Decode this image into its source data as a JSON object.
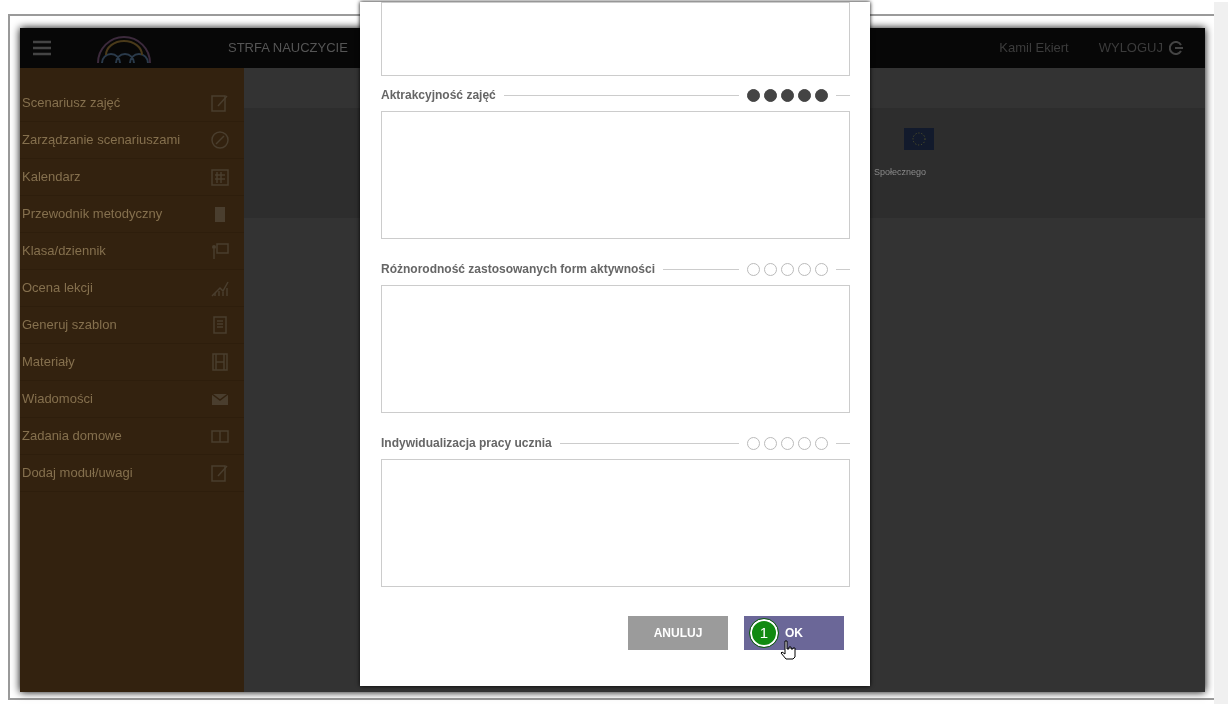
{
  "header": {
    "brand": "STRFA NAUCZYCIE",
    "user": "Kamil Ekiert",
    "logout": "WYLOGUJ"
  },
  "sidebar": {
    "items": [
      {
        "label": "Scenariusz zajęć",
        "kind": "edit"
      },
      {
        "label": "Zarządzanie scenariuszami",
        "kind": "compass"
      },
      {
        "label": "Kalendarz",
        "kind": "calendar"
      },
      {
        "label": "Przewodnik metodyczny",
        "kind": "book"
      },
      {
        "label": "Klasa/dziennik",
        "kind": "board"
      },
      {
        "label": "Ocena lekcji",
        "kind": "chart"
      },
      {
        "label": "Generuj szablon",
        "kind": "doc"
      },
      {
        "label": "Materiały",
        "kind": "film"
      },
      {
        "label": "Wiadomości",
        "kind": "mail"
      },
      {
        "label": "Zadania domowe",
        "kind": "openbook"
      },
      {
        "label": "Dodaj moduł/uwagi",
        "kind": "edit"
      }
    ]
  },
  "footer": {
    "text": "Społecznego"
  },
  "dialog": {
    "sections": [
      {
        "label": "Aktrakcyjność zajęć",
        "stars": 5
      },
      {
        "label": "Różnorodność zastosowanych form aktywności",
        "stars": 0
      },
      {
        "label": "Indywidualizacja pracy ucznia",
        "stars": 0
      }
    ],
    "buttons": [
      {
        "label": "ANULUJ",
        "kind": "cancel"
      },
      {
        "label": "OK",
        "kind": "ok"
      }
    ],
    "step_badge": "1"
  }
}
